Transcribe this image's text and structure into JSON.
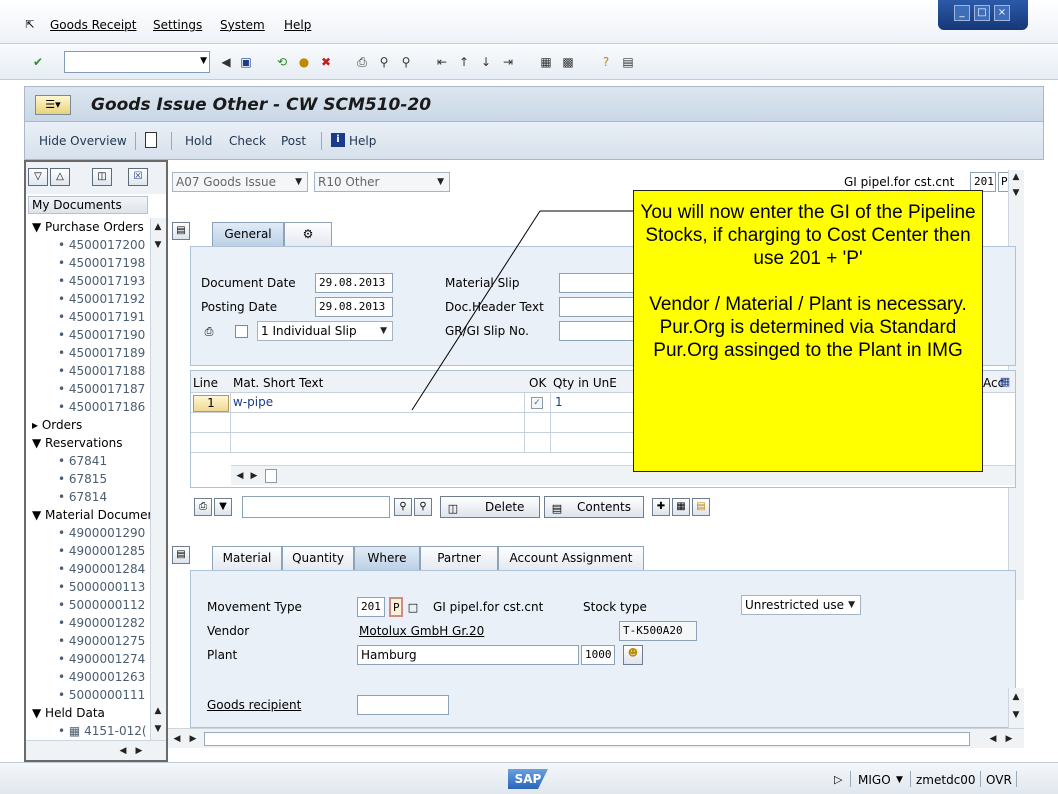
{
  "menu": {
    "items": [
      "Goods Receipt",
      "Settings",
      "System",
      "Help"
    ]
  },
  "title": {
    "text": "Goods Issue Other - CW SCM510-20"
  },
  "appbar": {
    "hide_overview": "Hide Overview",
    "hold": "Hold",
    "check": "Check",
    "post": "Post",
    "help": "Help"
  },
  "tree": {
    "my_documents": "My Documents",
    "purchase_orders": "Purchase Orders",
    "po_items": [
      "4500017200",
      "4500017198",
      "4500017193",
      "4500017192",
      "4500017191",
      "4500017190",
      "4500017189",
      "4500017188",
      "4500017187",
      "4500017186"
    ],
    "orders": "Orders",
    "reservations": "Reservations",
    "res_items": [
      "67841",
      "67815",
      "67814"
    ],
    "material_documents": "Material Documer",
    "md_items": [
      "4900001290",
      "4900001285",
      "4900001284",
      "5000000113",
      "5000000112",
      "4900001282",
      "4900001275",
      "4900001274",
      "4900001263",
      "5000000111"
    ],
    "held_data": "Held Data",
    "held_items": [
      "4151-012("
    ]
  },
  "header": {
    "action": "A07 Goods Issue",
    "reference": "R10 Other",
    "mvt_label": "GI pipel.for cst.cnt",
    "mvt_code": "201",
    "mvt_indicator": "P"
  },
  "tabs_top": {
    "general": "General"
  },
  "general": {
    "document_date_label": "Document Date",
    "document_date": "29.08.2013",
    "posting_date_label": "Posting Date",
    "posting_date": "29.08.2013",
    "slip_option": "1 Individual Slip",
    "material_slip_label": "Material Slip",
    "doc_header_text_label": "Doc.Header Text",
    "gr_gi_slip_label": "GR/GI Slip No."
  },
  "grid": {
    "col_line": "Line",
    "col_mat_short_text": "Mat. Short Text",
    "col_ok": "OK",
    "col_qty": "Qty in UnE",
    "col_acct": "Acc",
    "row1_line": "1",
    "row1_text": "w-pipe",
    "row1_qty": "1"
  },
  "grid_toolbar": {
    "delete": "Delete",
    "contents": "Contents"
  },
  "tabs_detail": {
    "material": "Material",
    "quantity": "Quantity",
    "where": "Where",
    "partner": "Partner",
    "account_assignment": "Account Assignment"
  },
  "where": {
    "movement_type_label": "Movement Type",
    "movement_type": "201",
    "movement_indicator": "P",
    "movement_desc": "GI pipel.for cst.cnt",
    "stock_type_label": "Stock type",
    "stock_type": "Unrestricted use",
    "vendor_label": "Vendor",
    "vendor_name": "Motolux GmbH Gr.20",
    "vendor_code": "T-K500A20",
    "plant_label": "Plant",
    "plant_name": "Hamburg",
    "plant_code": "1000",
    "goods_recipient_label": "Goods recipient"
  },
  "callout": {
    "para1": "You will now enter the GI of the Pipeline Stocks, if charging to Cost Center then use 201 + 'P'",
    "para2": "Vendor / Material / Plant is necessary. Pur.Org is determined via Standard Pur.Org assinged to the Plant in IMG"
  },
  "status": {
    "logo": "SAP",
    "transaction": "MIGO",
    "server": "zmetdc00",
    "mode": "OVR"
  },
  "colors": {
    "callout": "#ffff00",
    "panel": "#e9f0f8",
    "title_bar": "#c9d7e6"
  }
}
